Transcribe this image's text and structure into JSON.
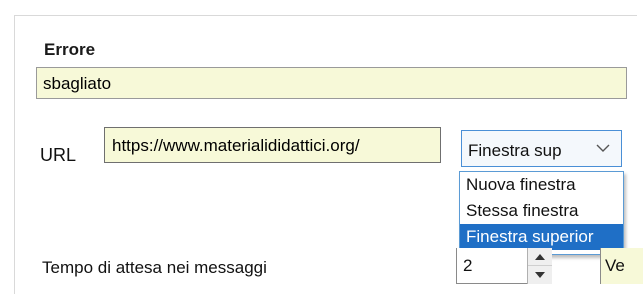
{
  "errore": {
    "label": "Errore",
    "value": "sbagliato"
  },
  "url": {
    "label": "URL",
    "value": "https://www.materialididattici.org/"
  },
  "target_select": {
    "selected": "Finestra sup",
    "icon": "chevron-down-icon",
    "options": [
      "Nuova finestra",
      "Stessa finestra",
      "Finestra superior"
    ],
    "highlighted_index": 2
  },
  "wait": {
    "label": "Tempo di attesa nei messaggi",
    "value": "2",
    "next_field_value": "Ve"
  },
  "colors": {
    "field_bg": "#f7f9d8",
    "focus_border": "#4a8fd6",
    "highlight": "#1f6fc6"
  }
}
